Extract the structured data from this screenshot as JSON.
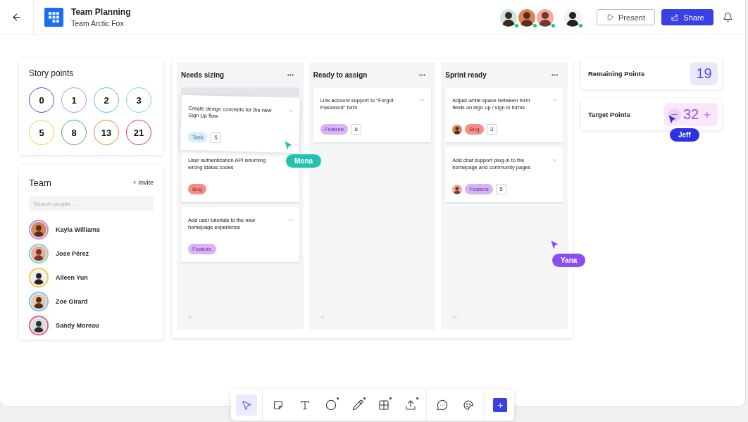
{
  "header": {
    "title": "Team Planning",
    "subtitle": "Team Arctic Fox",
    "collaborators": [
      {
        "online": true
      },
      {
        "online": true
      },
      {
        "online": true
      }
    ],
    "current_user": {
      "online": true
    },
    "buttons": [
      {
        "label": "Present",
        "kind": "outline"
      },
      {
        "label": "Share",
        "kind": "primary"
      }
    ]
  },
  "story_points": {
    "title": "Story points",
    "chips": [
      {
        "value": "0",
        "color": "#4b47d6"
      },
      {
        "value": "1",
        "color": "#b38cf0"
      },
      {
        "value": "2",
        "color": "#5db8ef"
      },
      {
        "value": "3",
        "color": "#6fdcc6"
      },
      {
        "value": "5",
        "color": "#f6c93b"
      },
      {
        "value": "8",
        "color": "#3cb44b"
      },
      {
        "value": "13",
        "color": "#ef7d2c"
      },
      {
        "value": "21",
        "color": "#df2a62"
      }
    ]
  },
  "team": {
    "title": "Team",
    "invite": "+ Invite",
    "search": {
      "placeholder": "Search people..."
    },
    "members": [
      {
        "name": "Kayla Williams",
        "color": "#b98df1"
      },
      {
        "name": "Jose Pérez",
        "color": "#72d7ca"
      },
      {
        "name": "Aileen Yun",
        "color": "#f5c845"
      },
      {
        "name": "Zoe Girard",
        "color": "#78c0ef"
      },
      {
        "name": "Sandy Moreau",
        "color": "#ec5a86"
      }
    ]
  },
  "board": {
    "columns": [
      {
        "title": "Needs sizing",
        "cards": [
          {
            "title": "Create design concepts for the new Sign Up flow",
            "dragging": true,
            "assignee": false,
            "tag": {
              "label": "Task",
              "kind": "task"
            },
            "points": "5"
          },
          {
            "title": "User authentication API returning wrong status codes",
            "dragging": false,
            "assignee": false,
            "tag": {
              "label": "Bug",
              "kind": "bug"
            }
          },
          {
            "title": "Add user tutorials to the new homepage experience",
            "dragging": false,
            "assignee": false,
            "tag": {
              "label": "Feature",
              "kind": "feature"
            }
          }
        ]
      },
      {
        "title": "Ready to assign",
        "cards": [
          {
            "title": "Link account support to \"Forgot Password\" form",
            "dragging": false,
            "assignee": false,
            "tag": {
              "label": "Feature",
              "kind": "feature"
            },
            "points": "8"
          }
        ]
      },
      {
        "title": "Sprint ready",
        "cards": [
          {
            "title": "Adjust white space between form fields on sign up / sign in forms",
            "dragging": false,
            "assignee": true,
            "tag": {
              "label": "Bug",
              "kind": "bug"
            },
            "points": "3"
          },
          {
            "title": "Add chat support plug-in to the homepage and community pages",
            "dragging": false,
            "assignee": true,
            "tag": {
              "label": "Feature",
              "kind": "feature"
            },
            "points": "5"
          }
        ]
      }
    ]
  },
  "remaining_points": {
    "label": "Remaining Points",
    "value": "19"
  },
  "target_points": {
    "label": "Target Points",
    "value": "32",
    "decrement_hovered": true
  },
  "cursors": [
    {
      "name": "Mona",
      "color": "#21c2b1"
    },
    {
      "name": "Yana",
      "color": "#8b4df2"
    },
    {
      "name": "Jeff",
      "color": "#2e32e6"
    }
  ],
  "toolbar": {
    "groups": [
      {
        "tools": [
          {
            "kind": "select",
            "selected": true,
            "submenu": false
          }
        ]
      },
      {
        "tools": [
          {
            "kind": "note",
            "selected": false,
            "submenu": false
          },
          {
            "kind": "text",
            "selected": false,
            "submenu": false
          },
          {
            "kind": "shape",
            "selected": false,
            "submenu": true
          },
          {
            "kind": "pen",
            "selected": false,
            "submenu": true
          },
          {
            "kind": "table",
            "selected": false,
            "submenu": true
          },
          {
            "kind": "upload",
            "selected": false,
            "submenu": true
          }
        ]
      },
      {
        "tools": [
          {
            "kind": "comment",
            "selected": false,
            "submenu": false
          },
          {
            "kind": "sticker",
            "selected": false,
            "submenu": false
          }
        ]
      }
    ]
  }
}
